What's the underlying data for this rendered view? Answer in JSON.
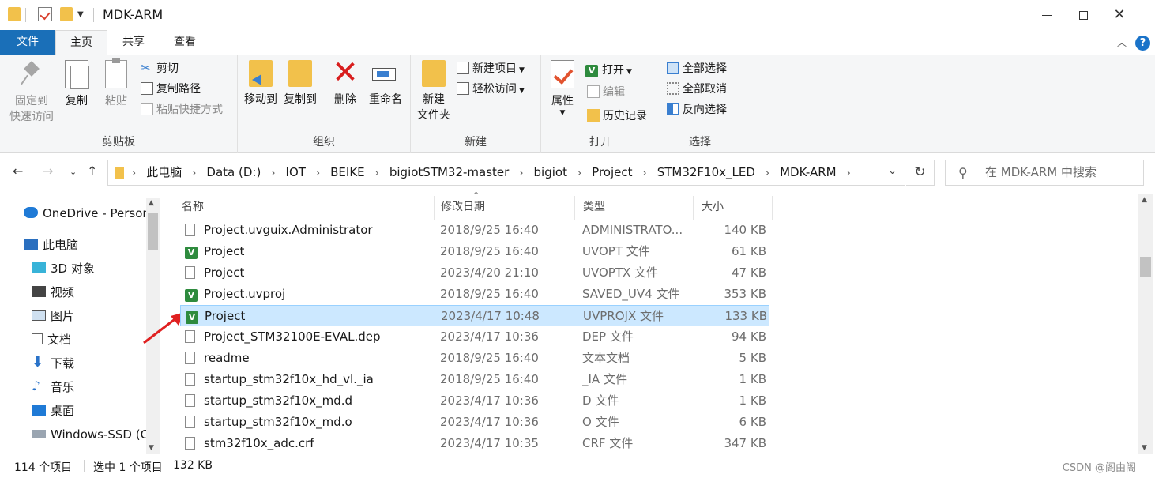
{
  "window": {
    "title": "MDK-ARM",
    "minimize_icon": "minimize-icon",
    "maximize_icon": "maximize-icon",
    "close_glyph": "✕"
  },
  "ribbon_tabs": [
    {
      "label": "文件",
      "active": false
    },
    {
      "label": "主页",
      "active": true
    },
    {
      "label": "共享",
      "active": false
    },
    {
      "label": "查看",
      "active": false
    }
  ],
  "help_glyph": "?",
  "collapse_glyph": "︿",
  "ribbon": {
    "clipboard": {
      "label": "剪贴板",
      "pin_label_1": "固定到",
      "pin_label_2": "快速访问",
      "copy": "复制",
      "paste": "粘贴",
      "cut": "剪切",
      "copy_path": "复制路径",
      "paste_shortcut": "粘贴快捷方式"
    },
    "organize": {
      "label": "组织",
      "move_to": "移动到",
      "copy_to": "复制到",
      "delete": "删除",
      "rename": "重命名"
    },
    "new": {
      "label": "新建",
      "new_folder_1": "新建",
      "new_folder_2": "文件夹",
      "new_item": "新建项目",
      "easy_access": "轻松访问"
    },
    "open": {
      "label": "打开",
      "properties": "属性",
      "open": "打开",
      "edit": "编辑",
      "history": "历史记录"
    },
    "select": {
      "label": "选择",
      "select_all": "全部选择",
      "select_none": "全部取消",
      "invert": "反向选择"
    }
  },
  "address": {
    "crumbs": [
      "此电脑",
      "Data (D:)",
      "IOT",
      "BEIKE",
      "bigiotSTM32-master",
      "bigiot",
      "Project",
      "STM32F10x_LED",
      "MDK-ARM"
    ],
    "search_placeholder": "在 MDK-ARM 中搜索"
  },
  "nav_pane": [
    {
      "label": "OneDrive - Personal",
      "icon": "onedrive-cloud-icon"
    },
    {
      "label": "此电脑",
      "icon": "this-pc-icon"
    },
    {
      "label": "3D 对象",
      "icon": "3d-objects-icon"
    },
    {
      "label": "视频",
      "icon": "video-icon"
    },
    {
      "label": "图片",
      "icon": "pictures-icon"
    },
    {
      "label": "文档",
      "icon": "documents-icon"
    },
    {
      "label": "下载",
      "icon": "download-icon"
    },
    {
      "label": "音乐",
      "icon": "music-icon"
    },
    {
      "label": "桌面",
      "icon": "desktop-icon"
    },
    {
      "label": "Windows-SSD (C:)",
      "icon": "drive-icon"
    }
  ],
  "columns": {
    "name": "名称",
    "modified": "修改日期",
    "type": "类型",
    "size": "大小"
  },
  "files": [
    {
      "name": "Project.uvguix.Administrator",
      "modified": "2018/9/25 16:40",
      "type": "ADMINISTRATO...",
      "size": "140 KB",
      "icon": "file-icon",
      "selected": false
    },
    {
      "name": "Project",
      "modified": "2018/9/25 16:40",
      "type": "UVOPT 文件",
      "size": "61 KB",
      "icon": "keil-uvision-icon",
      "selected": false
    },
    {
      "name": "Project",
      "modified": "2023/4/20 21:10",
      "type": "UVOPTX 文件",
      "size": "47 KB",
      "icon": "file-icon",
      "selected": false
    },
    {
      "name": "Project.uvproj",
      "modified": "2018/9/25 16:40",
      "type": "SAVED_UV4 文件",
      "size": "353 KB",
      "icon": "keil-uvision-icon",
      "selected": false
    },
    {
      "name": "Project",
      "modified": "2023/4/17 10:48",
      "type": "UVPROJX 文件",
      "size": "133 KB",
      "icon": "keil-uvision-icon",
      "selected": true
    },
    {
      "name": "Project_STM32100E-EVAL.dep",
      "modified": "2023/4/17 10:36",
      "type": "DEP 文件",
      "size": "94 KB",
      "icon": "file-icon",
      "selected": false
    },
    {
      "name": "readme",
      "modified": "2018/9/25 16:40",
      "type": "文本文档",
      "size": "5 KB",
      "icon": "file-icon",
      "selected": false
    },
    {
      "name": "startup_stm32f10x_hd_vl._ia",
      "modified": "2018/9/25 16:40",
      "type": "_IA 文件",
      "size": "1 KB",
      "icon": "file-icon",
      "selected": false
    },
    {
      "name": "startup_stm32f10x_md.d",
      "modified": "2023/4/17 10:36",
      "type": "D 文件",
      "size": "1 KB",
      "icon": "file-icon",
      "selected": false
    },
    {
      "name": "startup_stm32f10x_md.o",
      "modified": "2023/4/17 10:36",
      "type": "O 文件",
      "size": "6 KB",
      "icon": "file-icon",
      "selected": false
    },
    {
      "name": "stm32f10x_adc.crf",
      "modified": "2023/4/17 10:35",
      "type": "CRF 文件",
      "size": "347 KB",
      "icon": "file-icon",
      "selected": false
    }
  ],
  "status": {
    "count": "114 个项目",
    "selected": "选中 1 个项目",
    "selected_size": "132 KB",
    "watermark": "CSDN @阁由阁"
  },
  "colors": {
    "accent": "#1a6fb8",
    "selection": "#cce8ff",
    "annotation": "#e02020"
  }
}
